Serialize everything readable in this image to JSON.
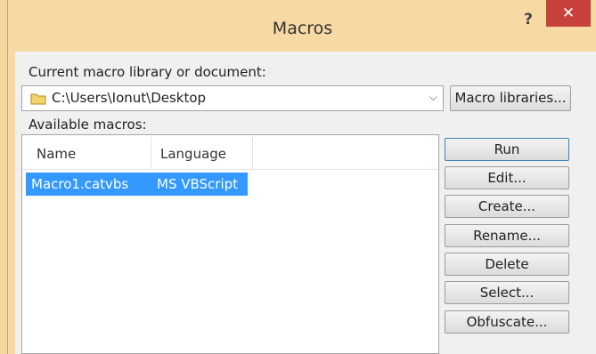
{
  "window": {
    "title": "Macros",
    "help": "?",
    "close": "✕"
  },
  "library": {
    "label": "Current macro library or document:",
    "path": "C:\\Users\\Ionut\\Desktop",
    "libraries_button": "Macro libraries..."
  },
  "macros": {
    "label": "Available macros:",
    "columns": [
      "Name",
      "Language"
    ],
    "rows": [
      {
        "name": "Macro1.catvbs",
        "language": "MS VBScript",
        "selected": true
      }
    ]
  },
  "buttons": {
    "run": "Run",
    "edit": "Edit...",
    "create": "Create...",
    "rename": "Rename...",
    "delete": "Delete",
    "select": "Select...",
    "obfuscate": "Obfuscate..."
  },
  "colors": {
    "titlebar": "#f6d9a3",
    "close": "#c7423b",
    "selection": "#3399ff"
  }
}
